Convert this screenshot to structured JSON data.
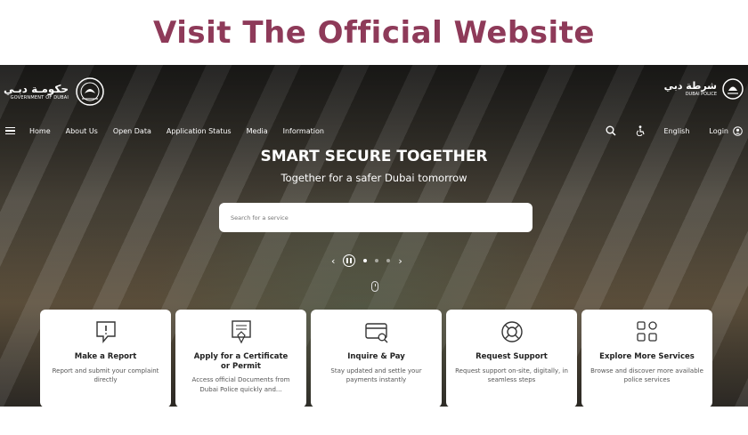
{
  "banner": {
    "title": "Visit The Official Website"
  },
  "header": {
    "gov_logo": {
      "arabic": "حكومـة دبـي",
      "english": "GOVERNMENT OF DUBAI"
    },
    "police_logo": {
      "arabic": "شرطة دبي",
      "english": "DUBAI POLICE"
    }
  },
  "nav": {
    "items": [
      "Home",
      "About Us",
      "Open Data",
      "Application Status",
      "Media",
      "Information"
    ],
    "language": "English",
    "login": "Login"
  },
  "hero": {
    "title": "SMART SECURE TOGETHER",
    "subtitle": "Together for a safer Dubai tomorrow",
    "search_placeholder": "Search for a service"
  },
  "carousel": {
    "prev": "‹",
    "next": "›",
    "slides": 3,
    "active": 1
  },
  "cards": [
    {
      "title": "Make a Report",
      "desc": "Report and submit your complaint directly",
      "icon": "report-icon"
    },
    {
      "title": "Apply for a Certificate or Permit",
      "desc": "Access official Documents from Dubai Police quickly and...",
      "icon": "certificate-icon"
    },
    {
      "title": "Inquire & Pay",
      "desc": "Stay updated and settle your payments instantly",
      "icon": "payment-icon"
    },
    {
      "title": "Request Support",
      "desc": "Request support on-site, digitally, in seamless steps",
      "icon": "support-icon"
    },
    {
      "title": "Explore More Services",
      "desc": "Browse and discover more available police services",
      "icon": "grid-icon"
    }
  ],
  "colors": {
    "banner_title": "#8e3a59",
    "card_bg": "#ffffff"
  }
}
